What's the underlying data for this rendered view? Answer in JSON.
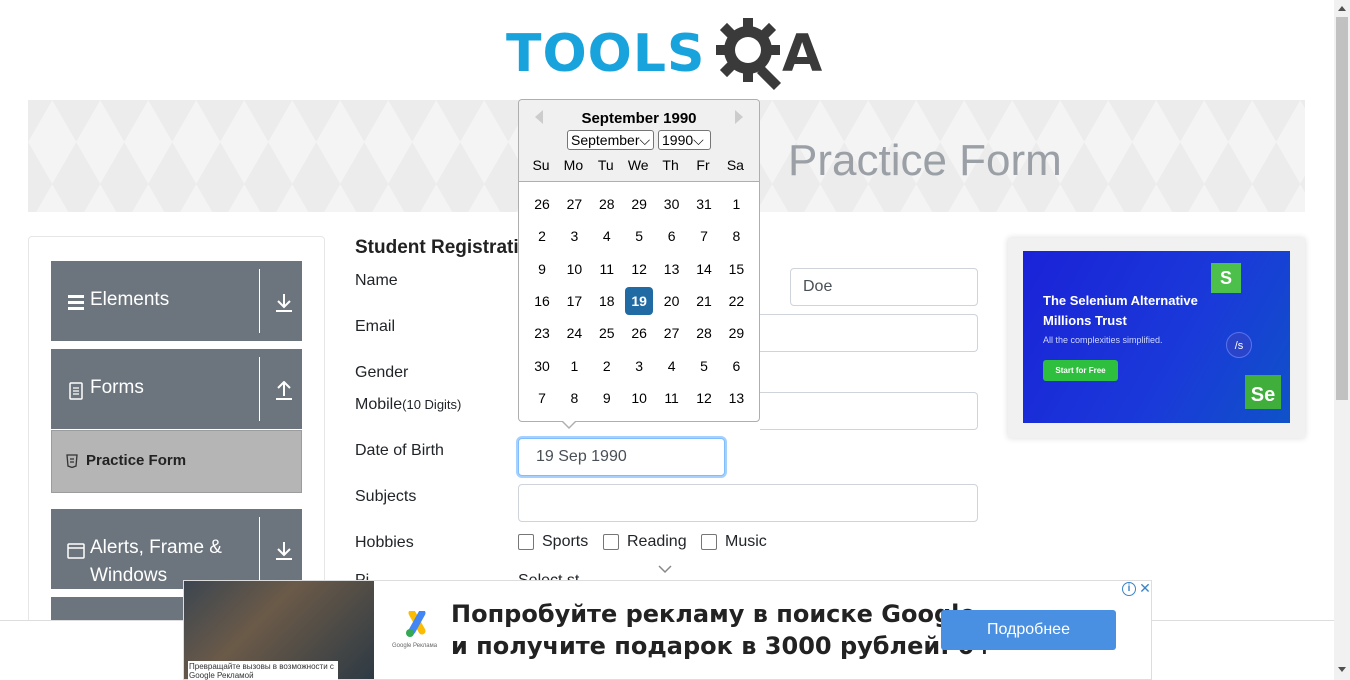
{
  "logo": {
    "text_main": "TOOLS",
    "text_end": "A"
  },
  "banner": {
    "title": "Practice Form"
  },
  "sidebar": {
    "groups": [
      {
        "label": "Elements",
        "icon": "hamburger-icon",
        "arrow": "download-icon"
      },
      {
        "label": "Forms",
        "icon": "form-icon",
        "arrow": "upload-icon"
      },
      {
        "label": "Alerts, Frame &",
        "label2": "Windows",
        "icon": "window-icon",
        "arrow": "download-icon"
      }
    ],
    "active_item": {
      "label": "Practice Form",
      "icon": "form-icon"
    }
  },
  "form": {
    "title": "Student Registration Form",
    "name_label": "Name",
    "last_name_value": "Doe",
    "email_label": "Email",
    "gender_label": "Gender",
    "mobile_label": "Mobile",
    "mobile_hint": "(10 Digits)",
    "dob_label": "Date of Birth",
    "dob_value": "19 Sep 1990",
    "subjects_label": "Subjects",
    "hobbies_label": "Hobbies",
    "hobbies": [
      "Sports",
      "Reading",
      "Music"
    ],
    "partial_label": "Pi",
    "partial_select": "Select st"
  },
  "datepicker": {
    "current_month": "September 1990",
    "month_select": "September",
    "year_select": "1990",
    "weekdays": [
      "Su",
      "Mo",
      "Tu",
      "We",
      "Th",
      "Fr",
      "Sa"
    ],
    "weeks": [
      [
        "26",
        "27",
        "28",
        "29",
        "30",
        "31",
        "1"
      ],
      [
        "2",
        "3",
        "4",
        "5",
        "6",
        "7",
        "8"
      ],
      [
        "9",
        "10",
        "11",
        "12",
        "13",
        "14",
        "15"
      ],
      [
        "16",
        "17",
        "18",
        "19",
        "20",
        "21",
        "22"
      ],
      [
        "23",
        "24",
        "25",
        "26",
        "27",
        "28",
        "29"
      ],
      [
        "30",
        "1",
        "2",
        "3",
        "4",
        "5",
        "6"
      ],
      [
        "7",
        "8",
        "9",
        "10",
        "11",
        "12",
        "13"
      ]
    ],
    "selected_day": "19"
  },
  "side_ad": {
    "title": "The Selenium Alternative Millions Trust",
    "subtitle": "All the complexities simplified.",
    "button": "Start for Free",
    "badge_s": "S",
    "badge_se": "Se",
    "circle_text": "/s"
  },
  "bottom_ad": {
    "line1": "Попробуйте рекламу в поиске Google",
    "line2": "и получите подарок в 3000 рублей. 0+",
    "button": "Подробнее",
    "photo_caption": "Превращайте вызовы в возможности с Google Рекламой",
    "logo_caption": "Google Реклама"
  },
  "colors": {
    "logo_blue": "#19a3dd",
    "sidebar_gray": "#6c757d",
    "selected_day": "#216ba5",
    "ad_button": "#4a90e2"
  }
}
